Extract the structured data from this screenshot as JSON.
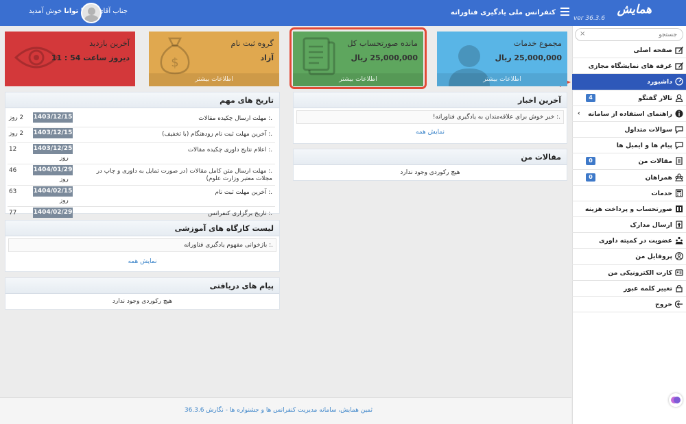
{
  "topbar": {
    "logo": "همایش",
    "version": "ver 36.3.6",
    "conference_title": "کنفرانس ملی یادگیری فناورانه",
    "welcome_prefix": "جناب آقای",
    "welcome_name": "سینا توانا",
    "welcome_suffix": "خوش آمدید"
  },
  "sidebar": {
    "search_placeholder": "جستجو",
    "search_clear": "×",
    "items": [
      {
        "label": "صفحه اصلی",
        "icon": "edit-icon"
      },
      {
        "label": "غرفه های نمایشگاه مجازی",
        "icon": "edit-icon"
      },
      {
        "label": "داشبورد",
        "icon": "gauge-icon",
        "active": true
      },
      {
        "label": "تالار گفتگو",
        "icon": "user-icon",
        "badge": "4"
      },
      {
        "label": "راهنمای استفاده از سامانه",
        "icon": "info-icon",
        "chevron": "›"
      },
      {
        "label": "سوالات متداول",
        "icon": "chat-icon"
      },
      {
        "label": "پیام ها و ایمیل ها",
        "icon": "chat-icon"
      },
      {
        "label": "مقالات من",
        "icon": "document-icon",
        "badge": "0"
      },
      {
        "label": "همراهان",
        "icon": "people-icon",
        "badge": "0"
      },
      {
        "label": "خدمات",
        "icon": "calculator-icon"
      },
      {
        "label": "صورتحساب و پرداخت هزینه",
        "icon": "invoice-icon"
      },
      {
        "label": "ارسال مدارک",
        "icon": "upload-icon"
      },
      {
        "label": "عضویت در کمیته داوری",
        "icon": "committee-icon"
      },
      {
        "label": "پروفایل من",
        "icon": "profile-icon"
      },
      {
        "label": "کارت الکترونیکی من",
        "icon": "card-icon"
      },
      {
        "label": "تغییر کلمه عبور",
        "icon": "lock-icon"
      },
      {
        "label": "خروج",
        "icon": "logout-icon"
      }
    ]
  },
  "cards": {
    "services_total": {
      "title": "مجموع خدمات",
      "value": "25,000,000 ریال",
      "footer": "اطلاعات بیشتر",
      "color": "#59b5e6"
    },
    "invoice_balance": {
      "title": "مانده صورتحساب کل",
      "value": "25,000,000 ریال",
      "footer": "اطلاعات بیشتر",
      "color": "#5ea65e"
    },
    "registration_group": {
      "title": "گروه ثبت نام",
      "value": "آزاد",
      "footer": "اطلاعات بیشتر",
      "color": "#e0a84f"
    },
    "last_visit": {
      "title": "آخرین بازدید",
      "value": "دیروز ساعت 54 : 11",
      "color": "#d3383a"
    }
  },
  "news": {
    "title": "آخرین اخبار",
    "items": [
      ".: خبر خوش برای علاقه‌مندان به یادگیری فناورانه!"
    ],
    "show_all": "نمایش همه"
  },
  "my_papers": {
    "title": "مقالات من",
    "empty": "هیچ رکوردی وجود ندارد"
  },
  "important_dates": {
    "title": "تاریخ های مهم",
    "rows": [
      {
        "text": ".: مهلت ارسال چکیده مقالات",
        "date": "1403/12/15",
        "days": "2 روز"
      },
      {
        "text": ".: آخرین مهلت ثبت نام زودهنگام (با تخفیف)",
        "date": "1403/12/15",
        "days": "2 روز"
      },
      {
        "text": ".: اعلام نتایج داوری چکیده مقالات",
        "date": "1403/12/25",
        "days": "12",
        "unit": "روز"
      },
      {
        "text": ".: مهلت ارسال متن کامل مقالات (در صورت تمایل به داوری و چاپ در مجلات معتبر وزارت علوم)",
        "date": "1404/01/29",
        "days": "46",
        "unit": "روز"
      },
      {
        "text": ".: آخرین مهلت ثبت نام",
        "date": "1404/02/15",
        "days": "63",
        "unit": "روز"
      },
      {
        "text": ".: تاریخ برگزاری کنفرانس",
        "date": "1404/02/29",
        "days": "77",
        "unit": "روز"
      }
    ]
  },
  "workshops": {
    "title": "لیست کارگاه های آموزشی",
    "items": [
      ".: بازخوانی مفهوم یادگیری فناورانه"
    ],
    "show_all": "نمایش همه"
  },
  "messages": {
    "title": "پیام های دریافتی",
    "empty": "هیچ رکوردی وجود ندارد"
  },
  "footer": {
    "text": "ثمین همایش، سامانه مدیریت کنفرانس ها و جشنواره ها - نگارش 36.3.6"
  },
  "colors": {
    "topbar": "#3a6fd0",
    "active_menu": "#2e58b9",
    "badge": "#3e79c9",
    "highlight": "#e24a36",
    "date_badge": "#7b8a9b"
  }
}
